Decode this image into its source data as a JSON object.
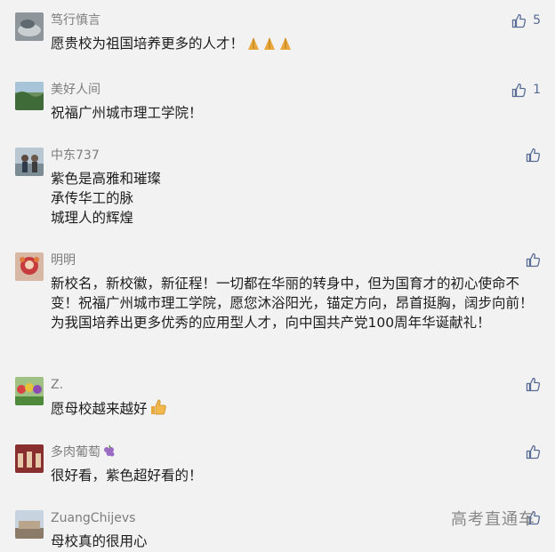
{
  "comments": [
    {
      "name": "笃行慎言",
      "text": [
        "愿贵校为祖国培养更多的人才！"
      ],
      "likes": "5",
      "name_icon": "",
      "tail_icon": "pray-icon"
    },
    {
      "name": "美好人间",
      "text": [
        "祝福广州城市理工学院！"
      ],
      "likes": "1",
      "name_icon": "",
      "tail_icon": ""
    },
    {
      "name": "中东737",
      "text": [
        "紫色是高雅和璀璨",
        "承传华工的脉",
        "城理人的辉煌"
      ],
      "likes": "",
      "name_icon": "",
      "tail_icon": ""
    },
    {
      "name": "明明",
      "text": [
        "新校名，新校徽，新征程！一切都在华丽的转身中，但为国育才的初心使命不变！祝福广州城市理工学院，愿您沐浴阳光，锚定方向，昂首挺胸，阔步向前！为我国培养出更多优秀的应用型人才，向中国共产党100周年华诞献礼！"
      ],
      "likes": "",
      "name_icon": "",
      "tail_icon": ""
    },
    {
      "name": "Z.",
      "text": [
        "愿母校越来越好"
      ],
      "likes": "",
      "name_icon": "",
      "tail_icon": "thumbs-up-emoji-icon"
    },
    {
      "name": "多肉葡萄",
      "text": [
        "很好看，紫色超好看的！"
      ],
      "likes": "",
      "name_icon": "grape-icon",
      "tail_icon": ""
    },
    {
      "name": "ZuangChijevs",
      "text": [
        "母校真的很用心"
      ],
      "likes": "",
      "name_icon": "",
      "tail_icon": ""
    }
  ],
  "watermark": "高考直通车",
  "colors": {
    "background": "#f2f2f2",
    "name": "#7d7d7d",
    "text": "#1c1c1c",
    "like": "#576b95"
  }
}
